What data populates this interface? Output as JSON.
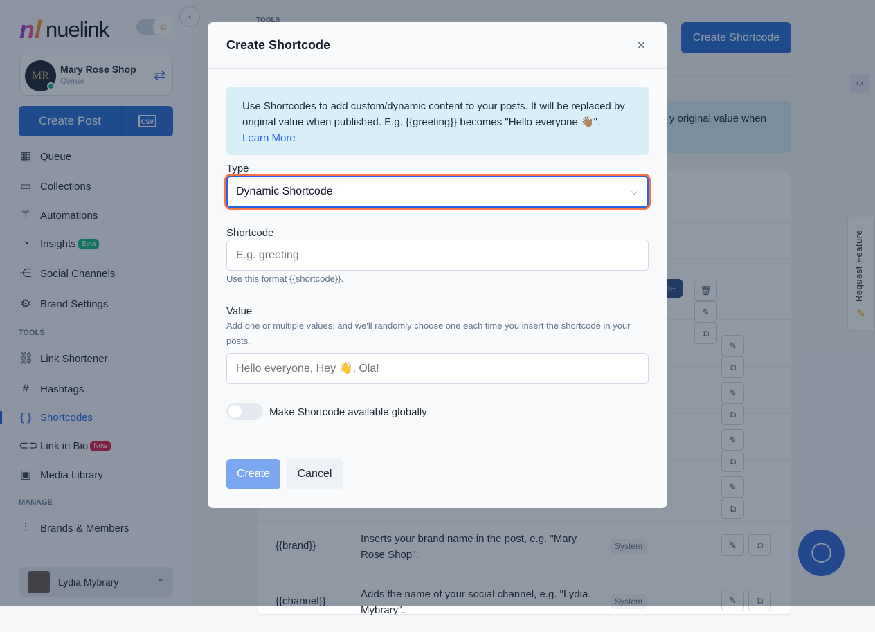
{
  "sidebar": {
    "logo": "nuelink",
    "logo_mark": "nl",
    "brand": {
      "name": "Mary Rose Shop",
      "role": "Owner",
      "avatar_text": "MR"
    },
    "create_post": "Create Post",
    "csv": "CSV",
    "items": [
      {
        "label": "Queue",
        "icon": "calendar-icon",
        "glyph": "▦"
      },
      {
        "label": "Collections",
        "icon": "folder-icon",
        "glyph": "▭"
      },
      {
        "label": "Automations",
        "icon": "magic-wand-icon",
        "glyph": "⚚"
      },
      {
        "label": "Insights",
        "icon": "pie-chart-icon",
        "glyph": "◔",
        "badge": "Beta"
      },
      {
        "label": "Social Channels",
        "icon": "share-icon",
        "glyph": "⋲"
      },
      {
        "label": "Brand Settings",
        "icon": "gear-icon",
        "glyph": "⚙"
      }
    ],
    "tools_label": "TOOLS",
    "tools": [
      {
        "label": "Link Shortener",
        "icon": "link-icon",
        "glyph": "⛓"
      },
      {
        "label": "Hashtags",
        "icon": "hashtag-icon",
        "glyph": "#"
      },
      {
        "label": "Shortcodes",
        "icon": "braces-icon",
        "glyph": "{ }"
      },
      {
        "label": "Link in Bio",
        "icon": "link-bio-icon",
        "glyph": "⊂⊃",
        "badge": "New"
      },
      {
        "label": "Media Library",
        "icon": "media-icon",
        "glyph": "▣"
      }
    ],
    "manage_label": "MANAGE",
    "manage": [
      {
        "label": "Brands & Members",
        "icon": "sliders-icon",
        "glyph": "⫶"
      }
    ],
    "user": "Lydia Mybrary"
  },
  "main": {
    "section": "TOOLS",
    "create_button": "Create Shortcode",
    "info_visible": "y original value when",
    "rows": [
      {
        "code": "{{brand}}",
        "desc": "Inserts your brand name in the post, e.g. \"Mary Rose Shop\".",
        "tag": "System"
      },
      {
        "code": "{{channel}}",
        "desc": "Adds the name of your social channel, e.g. \"Lydia Mybrary\".",
        "tag": "System"
      }
    ],
    "badge_fragment": "de"
  },
  "request_feature": "Request Feature",
  "modal": {
    "title": "Create Shortcode",
    "info": "Use Shortcodes to add custom/dynamic content to your posts. It will be replaced by original value when published. E.g. {{greeting}} becomes \"Hello everyone 👋🏽\".",
    "learn_more": "Learn More",
    "type_label": "Type",
    "type_value": "Dynamic Shortcode",
    "shortcode_label": "Shortcode",
    "shortcode_placeholder": "E.g. greeting",
    "shortcode_hint": "Use this format {{shortcode}}.",
    "value_label": "Value",
    "value_hint": "Add one or multiple values, and we'll randomly choose one each time you insert the shortcode in your posts.",
    "value_placeholder": "Hello everyone, Hey 👋, Ola!",
    "global_label": "Make Shortcode available globally",
    "global_on": false,
    "create": "Create",
    "cancel": "Cancel"
  },
  "colors": {
    "accent": "#2563eb",
    "focus_ring": "#f97341",
    "beta": "#10b981",
    "new": "#e11d48"
  }
}
